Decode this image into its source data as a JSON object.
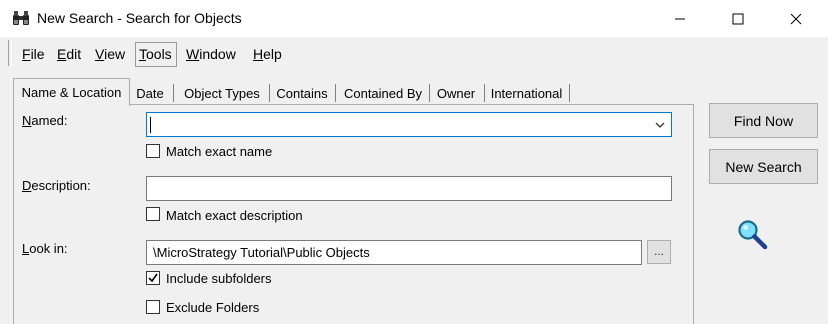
{
  "window": {
    "title": "New Search - Search for Objects",
    "icon": "binoculars-icon"
  },
  "menu": {
    "items": [
      {
        "label": "File",
        "accel": "F"
      },
      {
        "label": "Edit",
        "accel": "E"
      },
      {
        "label": "View",
        "accel": "V"
      },
      {
        "label": "Tools",
        "accel": "T"
      },
      {
        "label": "Window",
        "accel": "W"
      },
      {
        "label": "Help",
        "accel": "H"
      }
    ]
  },
  "tabs": [
    {
      "label": "Name & Location",
      "active": true
    },
    {
      "label": "Date",
      "active": false
    },
    {
      "label": "Object Types",
      "active": false
    },
    {
      "label": "Contains",
      "active": false
    },
    {
      "label": "Contained By",
      "active": false
    },
    {
      "label": "Owner",
      "active": false
    },
    {
      "label": "International",
      "active": false
    }
  ],
  "form": {
    "named": {
      "label_acc": "N",
      "label_rest": "amed:",
      "value": "",
      "match_exact_label": "Match exact name",
      "match_exact_checked": false
    },
    "description": {
      "label_acc": "D",
      "label_rest": "escription:",
      "value": "",
      "match_exact_label": "Match exact description",
      "match_exact_checked": false
    },
    "look_in": {
      "label_acc": "L",
      "label_rest": "ook in:",
      "value": "\\MicroStrategy Tutorial\\Public Objects",
      "browse_label": "...",
      "include_subfolders_label": "Include subfolders",
      "include_subfolders_checked": true,
      "exclude_folders_label": "Exclude Folders",
      "exclude_folders_checked": false
    }
  },
  "buttons": {
    "find_now": "Find Now",
    "new_search": "New Search"
  },
  "colors": {
    "focus_border": "#0078d7",
    "window_bg": "#f0f0f0"
  }
}
